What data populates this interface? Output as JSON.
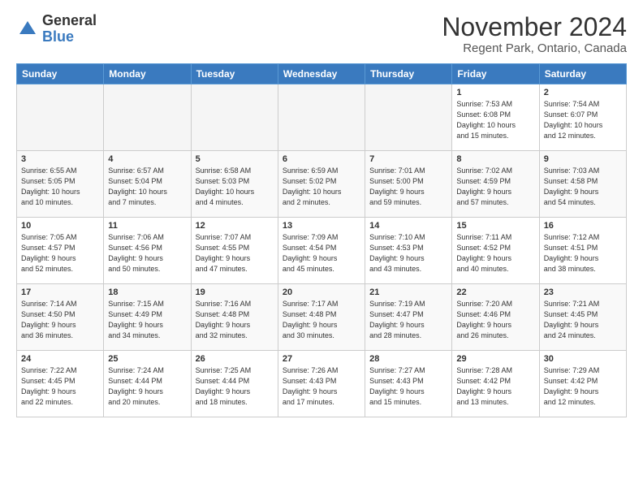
{
  "header": {
    "logo_general": "General",
    "logo_blue": "Blue",
    "month_title": "November 2024",
    "location": "Regent Park, Ontario, Canada"
  },
  "days_of_week": [
    "Sunday",
    "Monday",
    "Tuesday",
    "Wednesday",
    "Thursday",
    "Friday",
    "Saturday"
  ],
  "weeks": [
    [
      {
        "num": "",
        "detail": ""
      },
      {
        "num": "",
        "detail": ""
      },
      {
        "num": "",
        "detail": ""
      },
      {
        "num": "",
        "detail": ""
      },
      {
        "num": "",
        "detail": ""
      },
      {
        "num": "1",
        "detail": "Sunrise: 7:53 AM\nSunset: 6:08 PM\nDaylight: 10 hours\nand 15 minutes."
      },
      {
        "num": "2",
        "detail": "Sunrise: 7:54 AM\nSunset: 6:07 PM\nDaylight: 10 hours\nand 12 minutes."
      }
    ],
    [
      {
        "num": "3",
        "detail": "Sunrise: 6:55 AM\nSunset: 5:05 PM\nDaylight: 10 hours\nand 10 minutes."
      },
      {
        "num": "4",
        "detail": "Sunrise: 6:57 AM\nSunset: 5:04 PM\nDaylight: 10 hours\nand 7 minutes."
      },
      {
        "num": "5",
        "detail": "Sunrise: 6:58 AM\nSunset: 5:03 PM\nDaylight: 10 hours\nand 4 minutes."
      },
      {
        "num": "6",
        "detail": "Sunrise: 6:59 AM\nSunset: 5:02 PM\nDaylight: 10 hours\nand 2 minutes."
      },
      {
        "num": "7",
        "detail": "Sunrise: 7:01 AM\nSunset: 5:00 PM\nDaylight: 9 hours\nand 59 minutes."
      },
      {
        "num": "8",
        "detail": "Sunrise: 7:02 AM\nSunset: 4:59 PM\nDaylight: 9 hours\nand 57 minutes."
      },
      {
        "num": "9",
        "detail": "Sunrise: 7:03 AM\nSunset: 4:58 PM\nDaylight: 9 hours\nand 54 minutes."
      }
    ],
    [
      {
        "num": "10",
        "detail": "Sunrise: 7:05 AM\nSunset: 4:57 PM\nDaylight: 9 hours\nand 52 minutes."
      },
      {
        "num": "11",
        "detail": "Sunrise: 7:06 AM\nSunset: 4:56 PM\nDaylight: 9 hours\nand 50 minutes."
      },
      {
        "num": "12",
        "detail": "Sunrise: 7:07 AM\nSunset: 4:55 PM\nDaylight: 9 hours\nand 47 minutes."
      },
      {
        "num": "13",
        "detail": "Sunrise: 7:09 AM\nSunset: 4:54 PM\nDaylight: 9 hours\nand 45 minutes."
      },
      {
        "num": "14",
        "detail": "Sunrise: 7:10 AM\nSunset: 4:53 PM\nDaylight: 9 hours\nand 43 minutes."
      },
      {
        "num": "15",
        "detail": "Sunrise: 7:11 AM\nSunset: 4:52 PM\nDaylight: 9 hours\nand 40 minutes."
      },
      {
        "num": "16",
        "detail": "Sunrise: 7:12 AM\nSunset: 4:51 PM\nDaylight: 9 hours\nand 38 minutes."
      }
    ],
    [
      {
        "num": "17",
        "detail": "Sunrise: 7:14 AM\nSunset: 4:50 PM\nDaylight: 9 hours\nand 36 minutes."
      },
      {
        "num": "18",
        "detail": "Sunrise: 7:15 AM\nSunset: 4:49 PM\nDaylight: 9 hours\nand 34 minutes."
      },
      {
        "num": "19",
        "detail": "Sunrise: 7:16 AM\nSunset: 4:48 PM\nDaylight: 9 hours\nand 32 minutes."
      },
      {
        "num": "20",
        "detail": "Sunrise: 7:17 AM\nSunset: 4:48 PM\nDaylight: 9 hours\nand 30 minutes."
      },
      {
        "num": "21",
        "detail": "Sunrise: 7:19 AM\nSunset: 4:47 PM\nDaylight: 9 hours\nand 28 minutes."
      },
      {
        "num": "22",
        "detail": "Sunrise: 7:20 AM\nSunset: 4:46 PM\nDaylight: 9 hours\nand 26 minutes."
      },
      {
        "num": "23",
        "detail": "Sunrise: 7:21 AM\nSunset: 4:45 PM\nDaylight: 9 hours\nand 24 minutes."
      }
    ],
    [
      {
        "num": "24",
        "detail": "Sunrise: 7:22 AM\nSunset: 4:45 PM\nDaylight: 9 hours\nand 22 minutes."
      },
      {
        "num": "25",
        "detail": "Sunrise: 7:24 AM\nSunset: 4:44 PM\nDaylight: 9 hours\nand 20 minutes."
      },
      {
        "num": "26",
        "detail": "Sunrise: 7:25 AM\nSunset: 4:44 PM\nDaylight: 9 hours\nand 18 minutes."
      },
      {
        "num": "27",
        "detail": "Sunrise: 7:26 AM\nSunset: 4:43 PM\nDaylight: 9 hours\nand 17 minutes."
      },
      {
        "num": "28",
        "detail": "Sunrise: 7:27 AM\nSunset: 4:43 PM\nDaylight: 9 hours\nand 15 minutes."
      },
      {
        "num": "29",
        "detail": "Sunrise: 7:28 AM\nSunset: 4:42 PM\nDaylight: 9 hours\nand 13 minutes."
      },
      {
        "num": "30",
        "detail": "Sunrise: 7:29 AM\nSunset: 4:42 PM\nDaylight: 9 hours\nand 12 minutes."
      }
    ]
  ]
}
